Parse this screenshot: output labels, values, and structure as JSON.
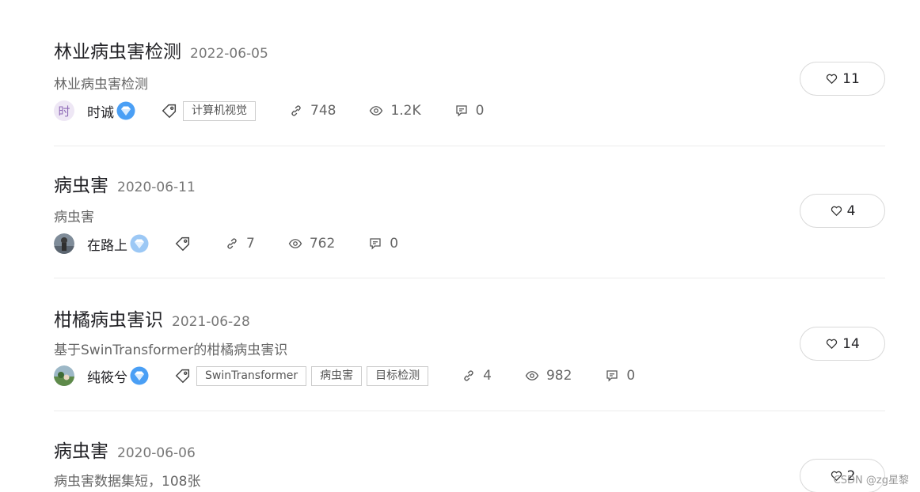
{
  "posts": [
    {
      "title": "林业病虫害检测",
      "date": "2022-06-05",
      "description": "林业病虫害检测",
      "author": "时诚",
      "avatar_text": "时",
      "tags": [
        "计算机视觉"
      ],
      "links": "748",
      "views": "1.2K",
      "comments": "0",
      "likes": "11"
    },
    {
      "title": "病虫害",
      "date": "2020-06-11",
      "description": "病虫害",
      "author": "在路上",
      "avatar_text": "",
      "tags": [],
      "links": "7",
      "views": "762",
      "comments": "0",
      "likes": "4"
    },
    {
      "title": "柑橘病虫害识",
      "date": "2021-06-28",
      "description": "基于SwinTransformer的柑橘病虫害识",
      "author": "纯筱兮",
      "avatar_text": "",
      "tags": [
        "SwinTransformer",
        "病虫害",
        "目标检测"
      ],
      "links": "4",
      "views": "982",
      "comments": "0",
      "likes": "14"
    },
    {
      "title": "病虫害",
      "date": "2020-06-06",
      "description": "病虫害数据集短，108张",
      "likes": "2"
    }
  ],
  "watermark": "CSDN @zg星黎",
  "icons": {
    "badge": "diamond-badge-icon",
    "tag": "tag-icon",
    "link": "link-icon",
    "view": "eye-icon",
    "comment": "comment-icon",
    "like": "heart-icon"
  },
  "colors": {
    "badge": "#4a9ff5",
    "badge_light": "#9cc8f5",
    "divider": "#ececec"
  }
}
